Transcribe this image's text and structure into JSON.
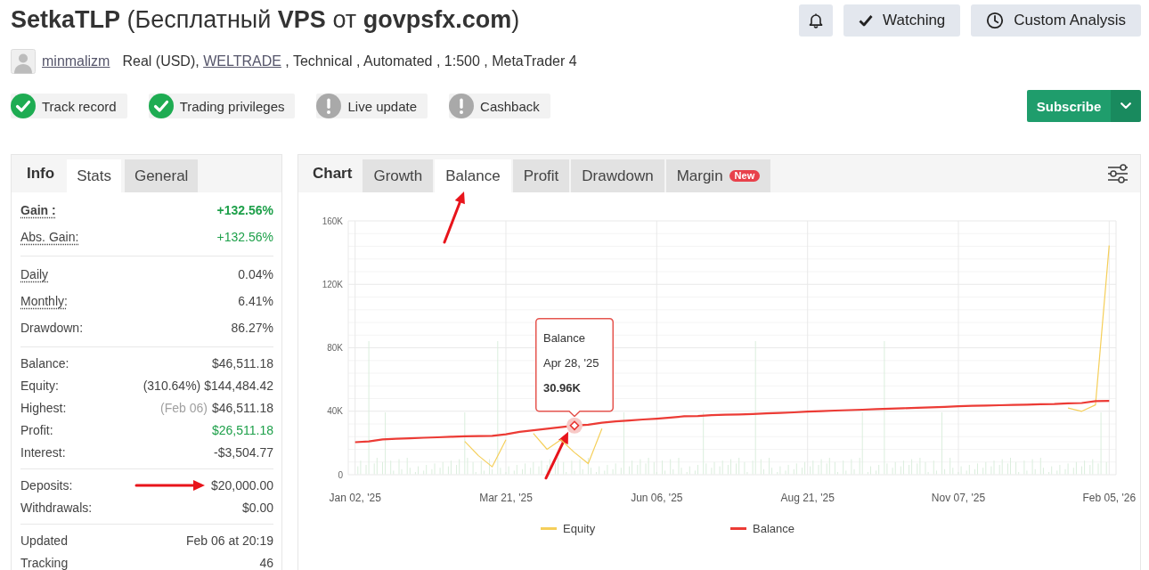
{
  "header": {
    "title": "**SetkaTLP** (Бесплатный **VPS** от **govpsfx.com**)",
    "actions": [
      {
        "kind": "bell"
      },
      {
        "kind": "check",
        "label": "Watching"
      },
      {
        "kind": "clock",
        "label": "Custom Analysis"
      }
    ],
    "author": "minmalizm",
    "account": {
      "prefix": "Real (USD),",
      "broker": "WELTRADE",
      "suffix": ", Technical , Automated , 1:500 , MetaTrader 4"
    },
    "badges": [
      {
        "label": "Track record",
        "passed": true
      },
      {
        "label": "Trading privileges",
        "passed": true
      },
      {
        "label": "Live update",
        "passed": false
      },
      {
        "label": "Cashback",
        "passed": false
      }
    ],
    "subscribe": "Subscribe"
  },
  "stats_panel": {
    "heading": "Info",
    "tabs": [
      {
        "label": "Stats",
        "selected": true
      },
      {
        "label": "General",
        "selected": false
      }
    ],
    "sections": [
      {
        "rows": [
          {
            "label": "Gain :",
            "value": "+132.56%",
            "positive": true,
            "bold": true,
            "hint": true
          },
          {
            "label": "Abs. Gain:",
            "value": "+132.56%",
            "positive": true,
            "hint": true
          }
        ]
      },
      {
        "rows": [
          {
            "label": "Daily",
            "value": "0.04%",
            "positive": false,
            "hint": true
          },
          {
            "label": "Monthly:",
            "value": "6.41%",
            "positive": false,
            "hint": true
          },
          {
            "label": "Drawdown:",
            "value": "86.27%",
            "positive": false,
            "hint": false
          }
        ]
      },
      {
        "rows": [
          {
            "label": "Balance:",
            "value": "$46,511.18",
            "positive": false,
            "hint": false
          },
          {
            "label": "Equity:",
            "value": "(310.64%) $144,484.42",
            "positive": false,
            "hint": false
          },
          {
            "label": "Highest:",
            "note": "(Feb 06)",
            "value": "$46,511.18",
            "positive": false,
            "hint": false
          },
          {
            "label": "Profit:",
            "value": "$26,511.18",
            "positive": true,
            "hint": false
          },
          {
            "label": "Interest:",
            "value": "-$3,504.77",
            "positive": false,
            "hint": false
          }
        ]
      },
      {
        "rows": [
          {
            "label": "Deposits:",
            "value": "$20,000.00",
            "positive": false,
            "hint": false,
            "arrow": true
          },
          {
            "label": "Withdrawals:",
            "value": "$0.00",
            "positive": false,
            "hint": false
          }
        ]
      },
      {
        "rows": [
          {
            "label": "Updated",
            "value": "Feb 06 at 20:19",
            "positive": false,
            "hint": false
          },
          {
            "label": "Tracking",
            "value": "46",
            "positive": false,
            "hint": false
          }
        ]
      }
    ]
  },
  "chart_panel": {
    "heading": "Chart",
    "tabs": [
      {
        "label": "Growth",
        "selected": false
      },
      {
        "label": "Balance",
        "selected": true,
        "arrow": true
      },
      {
        "label": "Profit",
        "selected": false
      },
      {
        "label": "Drawdown",
        "selected": false
      },
      {
        "label": "Margin",
        "selected": false,
        "badge": "New"
      }
    ],
    "chart_data": {
      "type": "line",
      "grid": true,
      "categories": [
        "Jan 02, '25",
        null,
        null,
        null,
        null,
        null,
        null,
        null,
        null,
        null,
        null,
        "Mar 21, '25",
        null,
        null,
        null,
        null,
        null,
        null,
        null,
        null,
        null,
        null,
        "Jun 06, '25",
        null,
        null,
        null,
        null,
        null,
        null,
        null,
        null,
        null,
        null,
        "Aug 21, '25",
        null,
        null,
        null,
        null,
        null,
        null,
        null,
        null,
        null,
        null,
        "Nov 07, '25",
        null,
        null,
        null,
        null,
        null,
        null,
        null,
        null,
        null,
        null,
        "Feb 05, '26"
      ],
      "series": [
        {
          "name": "Equity",
          "color": "#f5cf5a",
          "values": [
            null,
            null,
            null,
            null,
            null,
            null,
            null,
            null,
            21000,
            12000,
            5000,
            22000,
            null,
            26000,
            16000,
            22000,
            14000,
            7000,
            29000,
            null,
            null,
            null,
            null,
            null,
            null,
            null,
            null,
            null,
            null,
            null,
            null,
            null,
            null,
            null,
            null,
            null,
            null,
            null,
            null,
            null,
            null,
            null,
            null,
            null,
            null,
            null,
            null,
            null,
            null,
            null,
            null,
            null,
            42000,
            40000,
            44000,
            144500
          ]
        },
        {
          "name": "Balance",
          "color": "#ec3b35",
          "values": [
            20500,
            21000,
            22300,
            22600,
            22900,
            23300,
            23600,
            23900,
            24200,
            24300,
            24500,
            25500,
            27000,
            28000,
            29000,
            30000,
            31000,
            31500,
            32800,
            33600,
            34200,
            34800,
            35300,
            36000,
            36800,
            37000,
            37500,
            37800,
            38000,
            38300,
            38600,
            38900,
            39300,
            39800,
            40100,
            40400,
            40700,
            41000,
            41300,
            41600,
            41900,
            42200,
            42500,
            42800,
            43200,
            43400,
            43600,
            43800,
            44000,
            44200,
            44400,
            44600,
            45000,
            45200,
            46400,
            46500
          ]
        }
      ],
      "ylim": [
        0,
        160000
      ],
      "yticks": [
        {
          "value": 0,
          "label": "0"
        },
        {
          "value": 40000,
          "label": "40K"
        },
        {
          "value": 80000,
          "label": "80K"
        },
        {
          "value": 120000,
          "label": "120K"
        },
        {
          "value": 160000,
          "label": "160K"
        }
      ]
    },
    "tooltip": {
      "title": "Balance",
      "date": "Apr 28, '25",
      "value": "30.96K",
      "arrow": true
    }
  }
}
